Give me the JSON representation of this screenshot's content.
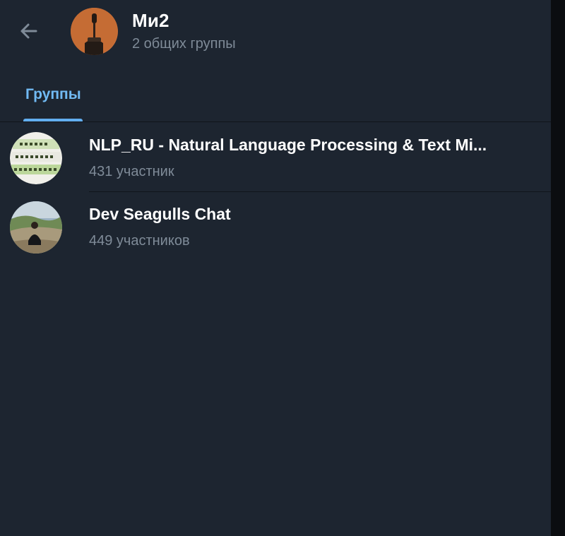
{
  "header": {
    "back_icon": "arrow-left-icon",
    "title": "Ми2",
    "subtitle": "2 общих группы"
  },
  "tabs": [
    {
      "label": "Группы",
      "active": true
    }
  ],
  "groups": [
    {
      "title": "NLP_RU - Natural Language Processing & Text Mi...",
      "subtitle": "431 участник"
    },
    {
      "title": "Dev Seagulls Chat",
      "subtitle": "449 участников"
    }
  ],
  "colors": {
    "background": "#1d2530",
    "accent": "#62aef0",
    "muted_text": "#7f8b98"
  }
}
